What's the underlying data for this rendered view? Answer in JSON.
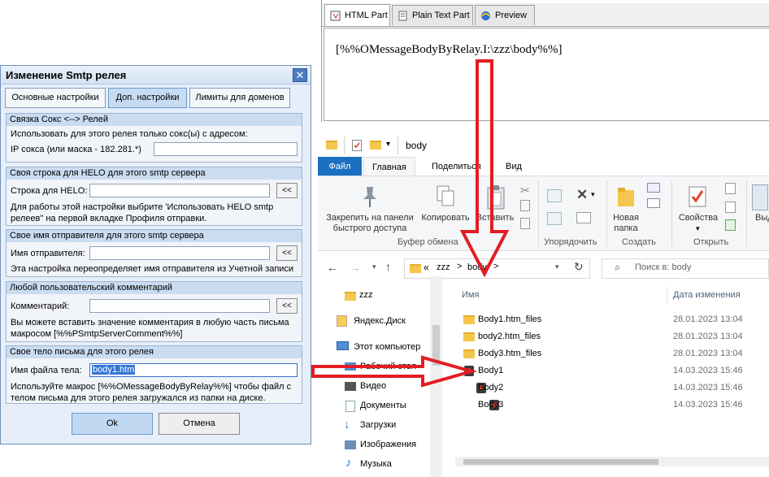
{
  "editor": {
    "tabs": [
      {
        "label": "HTML Part",
        "icon": "html-part-icon",
        "active": true
      },
      {
        "label": "Plain Text Part",
        "icon": "text-part-icon",
        "active": false
      },
      {
        "label": "Preview",
        "icon": "preview-icon",
        "active": false
      }
    ],
    "content": "[%%OMessageBodyByRelay.I:\\zzz\\body%%]"
  },
  "dialog": {
    "title": "Изменение Smtp релея",
    "close": "✕",
    "tabs": [
      "Основные настройки",
      "Доп. настройки",
      "Лимиты для доменов"
    ],
    "active_tab": "Доп. настройки",
    "groups": {
      "socks": {
        "title": "Связка Сокс <--> Релей",
        "line1": "Использовать для этого релея только сокс(ы) с адресом:",
        "label": "IP сокса (или маска - 182.281.*)",
        "value": ""
      },
      "helo": {
        "title": "Своя строка для HELO для этого smtp сервера",
        "label": "Строка для HELO:",
        "value": "",
        "button": "<<",
        "hint1": "Для работы этой настройки выбрите 'Использовать HELO smtp",
        "hint2": "релеев\" на первой вкладке Профиля отправки."
      },
      "sender": {
        "title": "Свое имя отправителя для этого smtp сервера",
        "label": "Имя отправителя:",
        "value": "",
        "button": "<<",
        "hint": "Эта настройка переопределяет имя отправителя из Учетной записи"
      },
      "comment": {
        "title": "Любой пользовательский комментарий",
        "label": "Комментарий:",
        "value": "",
        "button": "<<",
        "hint1": "Вы можете вставить значение комментария в любую часть письма",
        "hint2": "макросом [%%PSmtpServerComment%%]"
      },
      "body": {
        "title": "Свое тело письма для этого релея",
        "label": "Имя файла тела:",
        "value": "body1.htm",
        "hint1": "Используйте макрос [%%OMessageBodyByRelay%%] чтобы файл с",
        "hint2": "телом письма для этого релея загружался из папки на диске."
      }
    },
    "ok": "Ok",
    "cancel": "Отмена"
  },
  "explorer": {
    "title": "body",
    "ribbon_tabs": [
      "Файл",
      "Главная",
      "Поделиться",
      "Вид"
    ],
    "active_tab": "Главная",
    "ribbon": {
      "pin_line1": "Закрепить на панели",
      "pin_line2": "быстрого доступа",
      "copy": "Копировать",
      "paste": "Вставить",
      "new_folder_line1": "Новая",
      "new_folder_line2": "папка",
      "properties": "Свойства",
      "view_cut": "Выд",
      "groups": [
        "Буфер обмена",
        "Упорядочить",
        "Создать",
        "Открыть"
      ]
    },
    "address": [
      "«",
      "zzz",
      ">",
      "body",
      ">"
    ],
    "search_placeholder": "Поиск в: body",
    "nav": [
      {
        "label": "zzz",
        "icon": "folder-icon"
      },
      {
        "label": "Яндекс.Диск",
        "icon": "yandex-disk-icon"
      },
      {
        "label": "Этот компьютер",
        "icon": "computer-icon"
      },
      {
        "label": "Рабочий стол",
        "icon": "desktop-icon"
      },
      {
        "label": "Видео",
        "icon": "video-icon"
      },
      {
        "label": "Документы",
        "icon": "documents-icon"
      },
      {
        "label": "Загрузки",
        "icon": "downloads-icon"
      },
      {
        "label": "Изображения",
        "icon": "pictures-icon"
      },
      {
        "label": "Музыка",
        "icon": "music-icon"
      }
    ],
    "columns": {
      "name": "Имя",
      "date": "Дата изменения"
    },
    "files": [
      {
        "name": "Body1.htm_files",
        "date": "28.01.2023 13:04",
        "type": "folder"
      },
      {
        "name": "body2.htm_files",
        "date": "28.01.2023 13:04",
        "type": "folder"
      },
      {
        "name": "Body3.htm_files",
        "date": "28.01.2023 13:04",
        "type": "folder"
      },
      {
        "name": "Body1",
        "date": "14.03.2023 15:46",
        "type": "html"
      },
      {
        "name": "Body2",
        "date": "14.03.2023 15:46",
        "type": "html"
      },
      {
        "name": "Body3",
        "date": "14.03.2023 15:46",
        "type": "html"
      }
    ]
  },
  "colors": {
    "accent": "#1a6fc1",
    "arrow": "#e31d24",
    "dialog_bg": "#e6eefa",
    "group_head": "#c9dcf1"
  }
}
